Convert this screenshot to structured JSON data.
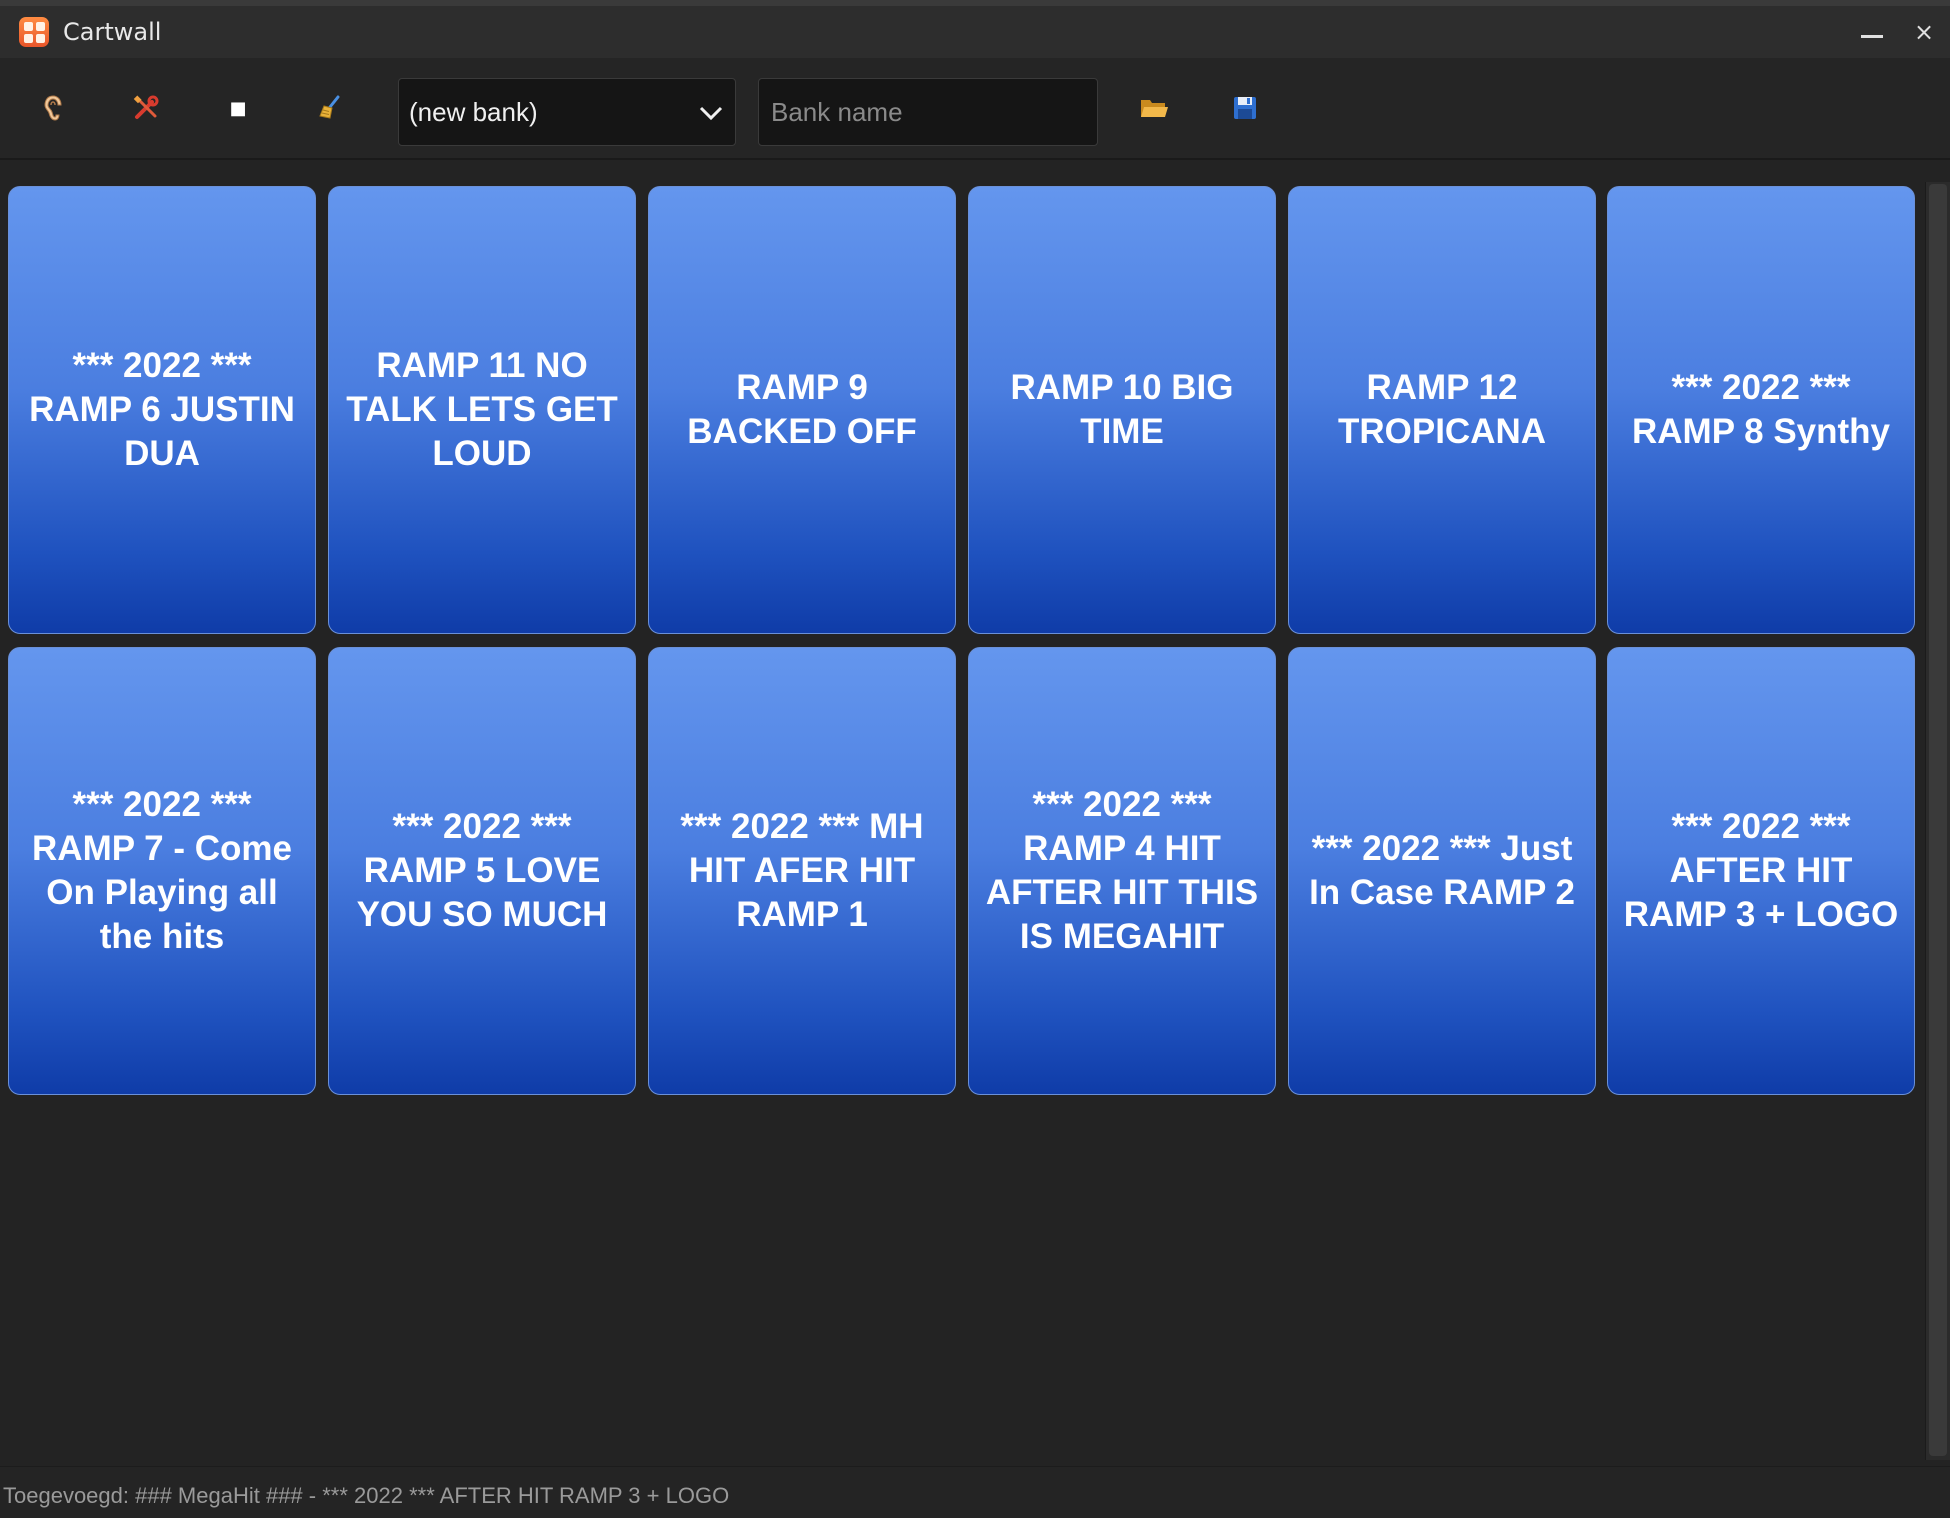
{
  "window": {
    "title": "Cartwall",
    "minimize_label": "—",
    "close_label": "×"
  },
  "toolbar": {
    "listen_icon": "ear-icon",
    "settings_icon": "tools-icon",
    "stop_glyph": "■",
    "clear_icon": "broom-icon",
    "bank_select_value": "(new bank)",
    "bank_name_placeholder": "Bank name",
    "open_icon": "folder-open-icon",
    "save_icon": "floppy-disk-icon"
  },
  "carts": [
    {
      "label": "*** 2022 *** RAMP 6 JUSTIN DUA"
    },
    {
      "label": "RAMP 11 NO TALK LETS GET LOUD"
    },
    {
      "label": "RAMP 9 BACKED OFF"
    },
    {
      "label": "RAMP 10 BIG TIME"
    },
    {
      "label": "RAMP 12 TROPICANA"
    },
    {
      "label": "*** 2022 *** RAMP 8 Synthy"
    },
    {
      "label": "*** 2022 *** RAMP 7 - Come On Playing all the hits"
    },
    {
      "label": "*** 2022 *** RAMP 5 LOVE YOU SO MUCH"
    },
    {
      "label": "*** 2022 *** MH HIT AFER HIT RAMP 1"
    },
    {
      "label": "*** 2022 *** RAMP 4 HIT AFTER HIT THIS IS MEGAHIT"
    },
    {
      "label": "*** 2022 *** Just In Case RAMP 2"
    },
    {
      "label": "*** 2022 *** AFTER HIT RAMP 3 + LOGO"
    }
  ],
  "colors": {
    "cart_top": "#6496ee",
    "cart_bottom": "#0f3ca8",
    "background": "#232323"
  },
  "status": {
    "text": "Toegevoegd: ### MegaHit ### - *** 2022 *** AFTER HIT RAMP 3 + LOGO"
  }
}
